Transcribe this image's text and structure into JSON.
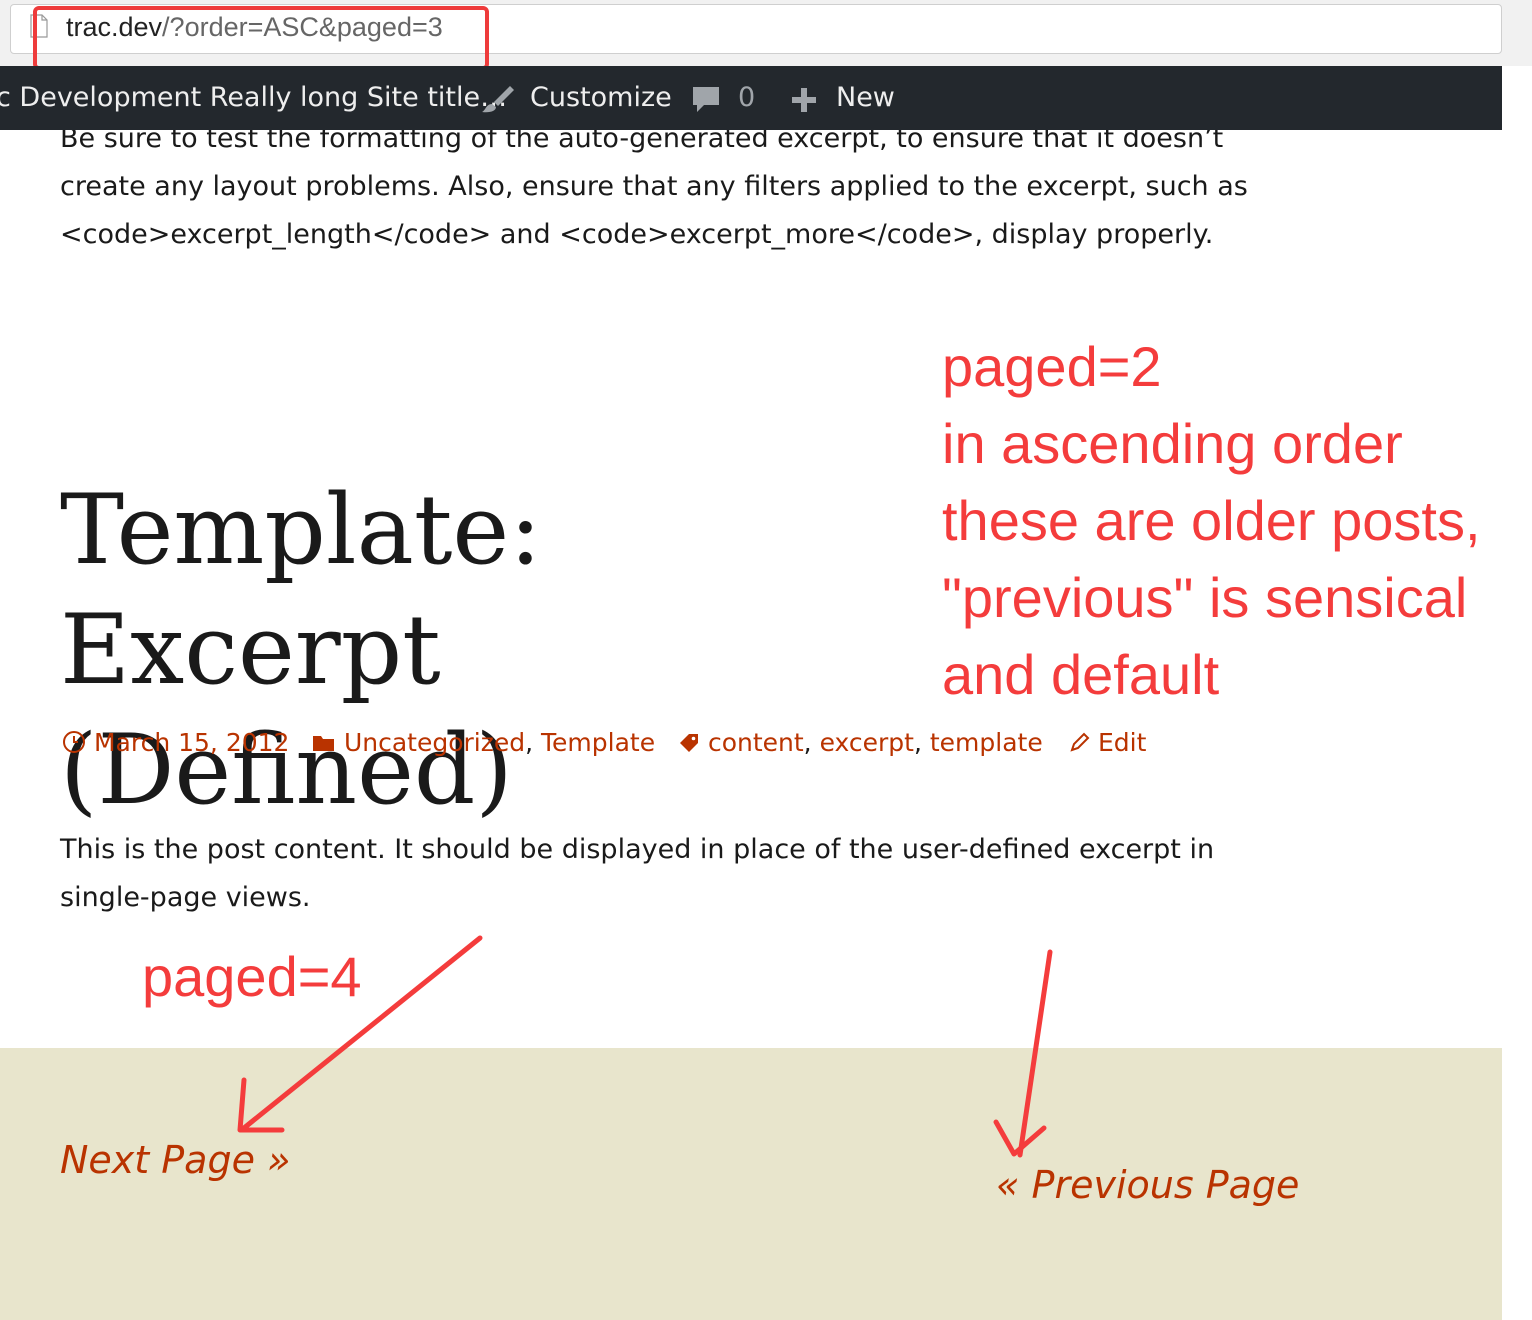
{
  "browser": {
    "url_host": "trac.dev",
    "url_rest": "/?order=ASC&paged=3"
  },
  "admin_bar": {
    "site_title": "c Development Really long Site title…",
    "customize_label": "Customize",
    "comments_count": "0",
    "new_label": "New"
  },
  "excerpt": {
    "line1": "Be sure to test the formatting of the auto-generated excerpt, to ensure that it doesn’t",
    "line2": "create any layout problems. Also, ensure that any filters applied to the excerpt, such as",
    "line3": "<code>excerpt_length</code> and <code>excerpt_more</code>, display properly."
  },
  "post": {
    "title_line1": "Template: Excerpt",
    "title_line2": "(Defined)",
    "date": "March 15, 2012",
    "categories": [
      "Uncategorized",
      "Template"
    ],
    "tags": [
      "content",
      "excerpt",
      "template"
    ],
    "edit_label": "Edit",
    "content_line1": "This is the post content. It should be displayed in place of the user-defined excerpt in",
    "content_line2": "single-page views."
  },
  "navigation": {
    "next_label": "Next Page »",
    "previous_label": "« Previous Page"
  },
  "annotations": {
    "note_lines": [
      "paged=2",
      "in ascending order",
      "these are older posts,",
      "\"previous\" is sensical",
      "and default"
    ],
    "paged4": "paged=4"
  },
  "colors": {
    "admin_bar": "#23282d",
    "link": "#b93300",
    "nav_background": "#e8e5cc",
    "annotation": "#f43c3c"
  }
}
